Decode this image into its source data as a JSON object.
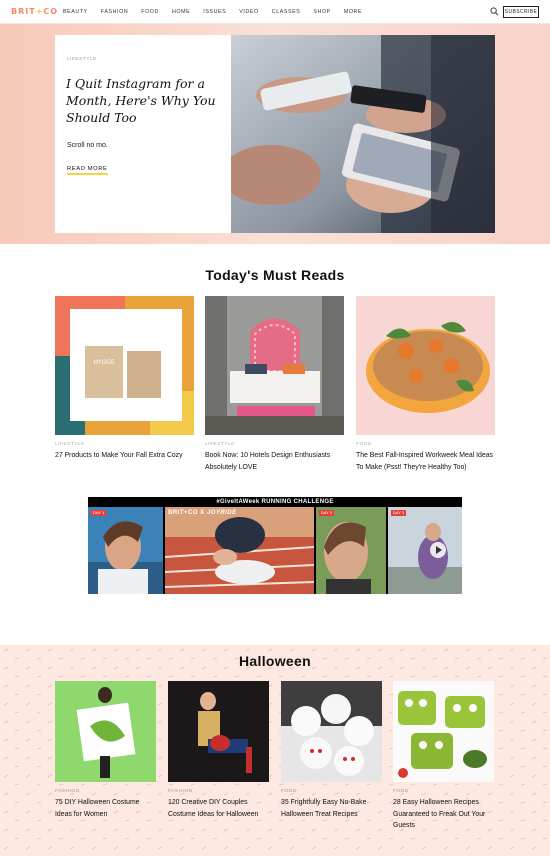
{
  "brand": {
    "logo_left": "BRIT",
    "logo_plus": "+",
    "logo_right": "CO"
  },
  "nav": {
    "items": [
      "Beauty",
      "Fashion",
      "Food",
      "Home",
      "Issues",
      "Video",
      "Classes",
      "Shop",
      "More"
    ],
    "subscribe_label": "Subscribe"
  },
  "hero": {
    "category": "Lifestyle",
    "title": "I Quit Instagram for a Month, Here's Why You Should Too",
    "description": "Scroll no mo.",
    "cta": "Read More"
  },
  "must_reads": {
    "title": "Today's Must Reads",
    "items": [
      {
        "category": "Lifestyle",
        "title": "27 Products to Make Your Fall Extra Cozy"
      },
      {
        "category": "Lifestyle",
        "title": "Book Now: 10 Hotels Design Enthusiasts Absolutely LOVE"
      },
      {
        "category": "Food",
        "title": "The Best Fall-Inspired Workweek Meal Ideas To Make (Psst! They're Healthy Too)"
      }
    ]
  },
  "video": {
    "header": "#GiveItAWeek RUNNING CHALLENGE",
    "brand_tag": "BRIT+CO X",
    "nike_tag": "JOYRIDE",
    "days": [
      "DAY 1",
      "DAY 2",
      "DAY 3"
    ],
    "product_text": "HYGGE"
  },
  "halloween": {
    "title": "Halloween",
    "items": [
      {
        "category": "Fashion",
        "title": "75 DIY Halloween Costume Ideas for Women"
      },
      {
        "category": "Fashion",
        "title": "120 Creative DIY Couples Costume Ideas for Halloween"
      },
      {
        "category": "Food",
        "title": "35 Frightfully Easy No-Bake Halloween Treat Recipes"
      },
      {
        "category": "Food",
        "title": "28 Easy Halloween Recipes Guaranteed to Freak Out Your Guests"
      }
    ]
  },
  "colors": {
    "accent_coral": "#f08b6e",
    "accent_yellow": "#f5c23b",
    "hero_bg": "#f7c9b8",
    "section_bg": "#fde8e2"
  }
}
